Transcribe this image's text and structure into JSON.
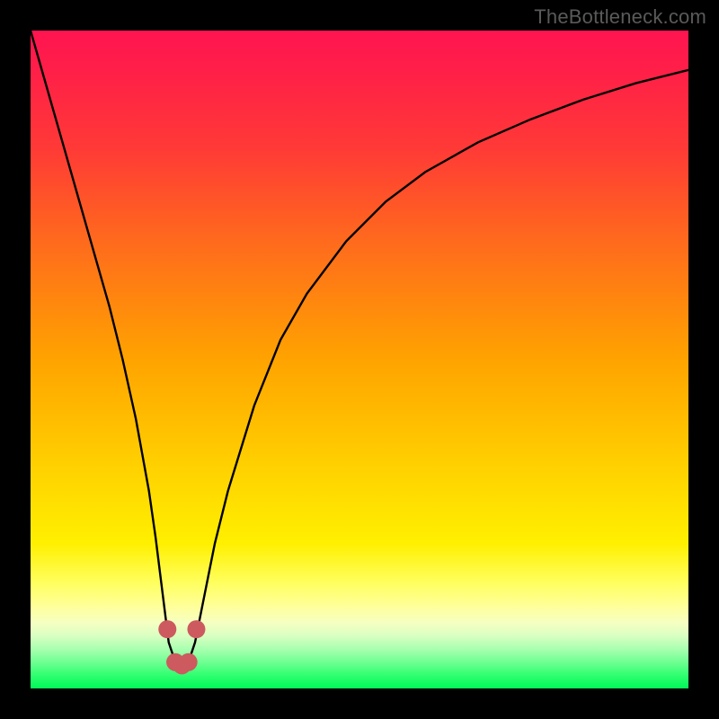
{
  "watermark": "TheBottleneck.com",
  "chart_data": {
    "type": "line",
    "title": "",
    "xlabel": "",
    "ylabel": "",
    "xlim": [
      0,
      100
    ],
    "ylim": [
      0,
      100
    ],
    "grid": false,
    "legend": false,
    "series": [
      {
        "name": "bottleneck-curve",
        "x": [
          0,
          2,
          4,
          6,
          8,
          10,
          12,
          14,
          16,
          18,
          19,
          20,
          21,
          22,
          23,
          24,
          25,
          26,
          28,
          30,
          34,
          38,
          42,
          48,
          54,
          60,
          68,
          76,
          84,
          92,
          100
        ],
        "y": [
          100,
          93,
          86,
          79,
          72,
          65,
          58,
          50,
          41,
          30,
          23,
          15,
          7,
          4,
          3.5,
          4,
          7,
          12,
          22,
          30,
          43,
          53,
          60,
          68,
          74,
          78.5,
          83,
          86.5,
          89.5,
          92,
          94
        ]
      }
    ],
    "markers": [
      {
        "name": "min-marker-left",
        "x": 22.0,
        "y": 4.0
      },
      {
        "name": "min-marker-mid",
        "x": 23.0,
        "y": 3.5
      },
      {
        "name": "min-marker-right",
        "x": 24.0,
        "y": 4.0
      },
      {
        "name": "shoulder-marker-left",
        "x": 20.8,
        "y": 9.0
      },
      {
        "name": "shoulder-marker-right",
        "x": 25.2,
        "y": 9.0
      }
    ],
    "gradient_stops": [
      {
        "pos": 0.0,
        "color": "#ff1450"
      },
      {
        "pos": 0.06,
        "color": "#ff1f48"
      },
      {
        "pos": 0.18,
        "color": "#ff3a36"
      },
      {
        "pos": 0.32,
        "color": "#ff6a1d"
      },
      {
        "pos": 0.5,
        "color": "#ffa300"
      },
      {
        "pos": 0.66,
        "color": "#ffd000"
      },
      {
        "pos": 0.78,
        "color": "#fff000"
      },
      {
        "pos": 0.84,
        "color": "#ffff60"
      },
      {
        "pos": 0.875,
        "color": "#ffff9a"
      },
      {
        "pos": 0.9,
        "color": "#f6ffc2"
      },
      {
        "pos": 0.92,
        "color": "#d9ffc2"
      },
      {
        "pos": 0.94,
        "color": "#a9ffb0"
      },
      {
        "pos": 0.96,
        "color": "#6fff92"
      },
      {
        "pos": 0.98,
        "color": "#30ff70"
      },
      {
        "pos": 1.0,
        "color": "#00f858"
      }
    ],
    "marker_color": "#cc5a5f"
  }
}
